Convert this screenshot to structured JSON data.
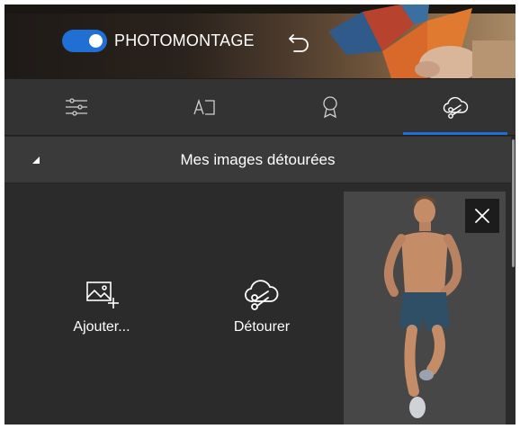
{
  "header": {
    "title": "PHOTOMONTAGE",
    "toggle_on": true,
    "undo_icon": "undo-icon",
    "accent_color": "#1f6fd4"
  },
  "tabs": [
    {
      "icon": "sliders-icon",
      "selected": false
    },
    {
      "icon": "text-frame-icon",
      "selected": false
    },
    {
      "icon": "badge-icon",
      "selected": false
    },
    {
      "icon": "cutout-cloud-scissors-icon",
      "selected": true
    }
  ],
  "section": {
    "title": "Mes images détourées",
    "collapse_icon": "triangle-collapse-icon"
  },
  "actions": {
    "add_label": "Ajouter...",
    "add_icon": "add-image-icon",
    "cutout_label": "Détourer",
    "cutout_icon": "cutout-cloud-scissors-icon"
  },
  "thumbnail": {
    "remove_icon": "close-icon"
  }
}
